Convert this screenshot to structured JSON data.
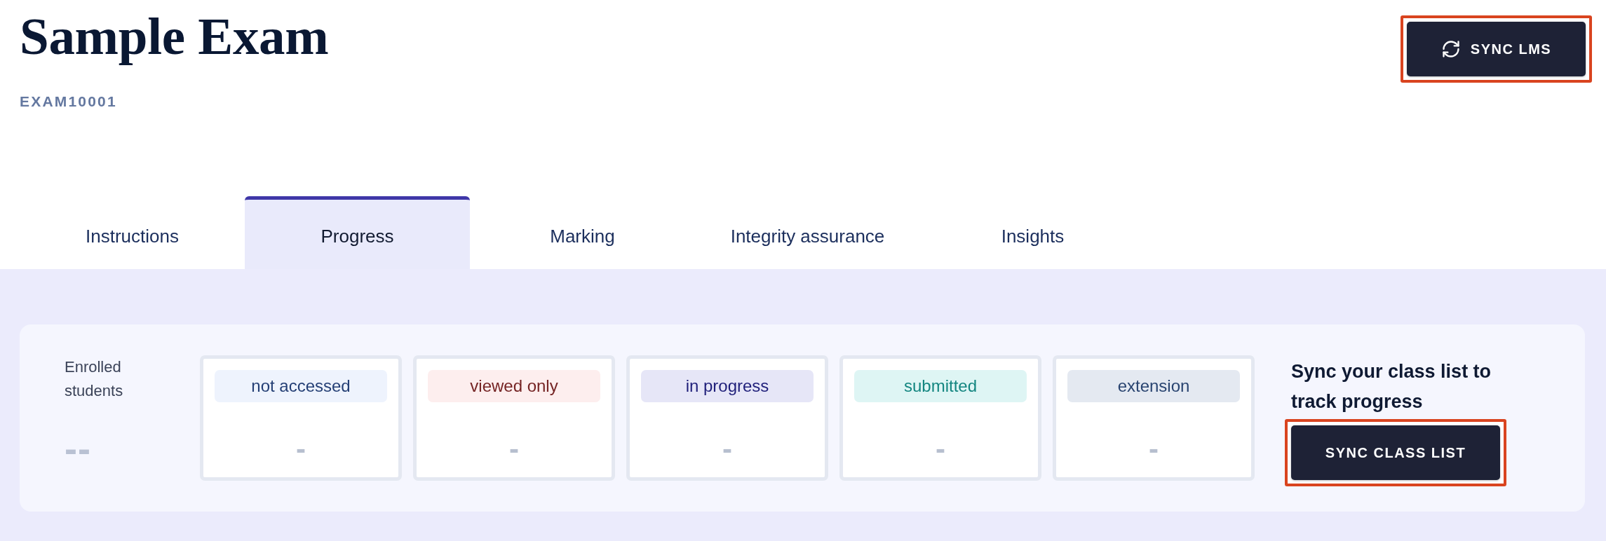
{
  "header": {
    "title": "Sample Exam",
    "code": "EXAM10001",
    "sync_button": {
      "label": "SYNC LMS",
      "highlighted": true
    }
  },
  "tabs": [
    {
      "label": "Instructions",
      "selected": false
    },
    {
      "label": "Progress",
      "selected": true
    },
    {
      "label": "Marking",
      "selected": false
    },
    {
      "label": "Integrity assurance",
      "selected": false
    },
    {
      "label": "Insights",
      "selected": false
    }
  ],
  "progress": {
    "enrolled": {
      "label": "Enrolled students",
      "value": "--"
    },
    "statuses": [
      {
        "label": "not accessed",
        "value": "-",
        "color": "#eef3fd"
      },
      {
        "label": "viewed only",
        "value": "-",
        "color": "#fdeeee"
      },
      {
        "label": "in progress",
        "value": "-",
        "color": "#e6e6f7"
      },
      {
        "label": "submitted",
        "value": "-",
        "color": "#def5f4"
      },
      {
        "label": "extension",
        "value": "-",
        "color": "#e4e9f1"
      }
    ],
    "sync_prompt": "Sync your class list to track progress",
    "sync_button": {
      "label": "SYNC CLASS LIST",
      "highlighted": true
    }
  }
}
